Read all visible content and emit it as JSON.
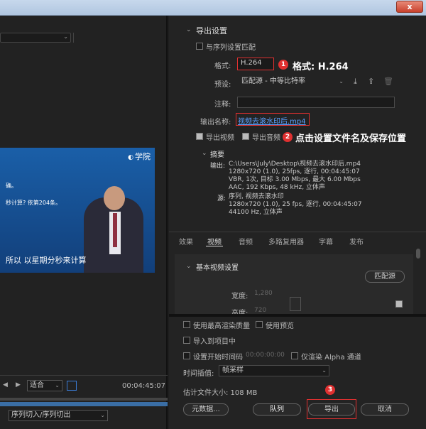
{
  "window": {
    "close_label": "x"
  },
  "left": {
    "video_logo": "学院",
    "video_line1": "确。",
    "video_line2": "秒计算? 依第204条。",
    "video_caption": "所以 以星期分秒来计算",
    "zoom": "适合",
    "timecode": "00:04:45:07",
    "source_range": "序列切入/序列切出"
  },
  "export": {
    "section_title": "导出设置",
    "match_sequence": "与序列设置匹配",
    "format_label": "格式:",
    "format_value": "H.264",
    "preset_label": "预设:",
    "preset_value": "匹配源 - 中等比特率",
    "comment_label": "注释:",
    "output_name_label": "输出名称:",
    "output_name_value": "视频去滚水印后.mp4",
    "export_video": "导出视频",
    "export_audio": "导出音频",
    "summary_title": "摘要",
    "output_label": "输出:",
    "output_lines": [
      "C:\\Users\\July\\Desktop\\视频去滚水印后.mp4",
      "1280x720 (1.0), 25fps, 逐行, 00:04:45:07",
      "VBR, 1次, 目标 3.00 Mbps, 最大 6.00 Mbps",
      "AAC, 192 Kbps, 48 kHz, 立体声"
    ],
    "source_label": "源:",
    "source_lines": [
      "序列, 视频去滚水印",
      "1280x720 (1.0), 25 fps, 逐行, 00:04:45:07",
      "44100 Hz, 立体声"
    ]
  },
  "annotations": {
    "n1": "1",
    "c1": "格式: H.264",
    "n2": "2",
    "c2": "点击设置文件名及保存位置",
    "n3": "3"
  },
  "tabs": [
    "效果",
    "视频",
    "音频",
    "多路复用器",
    "字幕",
    "发布"
  ],
  "video_settings": {
    "title": "基本视频设置",
    "match_source": "匹配源",
    "width_label": "宽度:",
    "width_value": "1,280",
    "height_label": "高度:",
    "height_value": "720"
  },
  "bottom": {
    "max_quality": "使用最高渲染质量",
    "use_previews": "使用预览",
    "import_project": "导入到项目中",
    "set_start_tc": "设置开始时间码",
    "start_tc": "00:00:00:00",
    "alpha_only": "仅渲染 Alpha 通道",
    "interp_label": "时间插值:",
    "interp_value": "帧采样",
    "filesize": "估计文件大小: 108 MB",
    "metadata_btn": "元数据...",
    "queue_btn": "队列",
    "export_btn": "导出",
    "cancel_btn": "取消"
  },
  "colors": {
    "accent": "#5aa0ff",
    "annotation_red": "#e03030"
  }
}
